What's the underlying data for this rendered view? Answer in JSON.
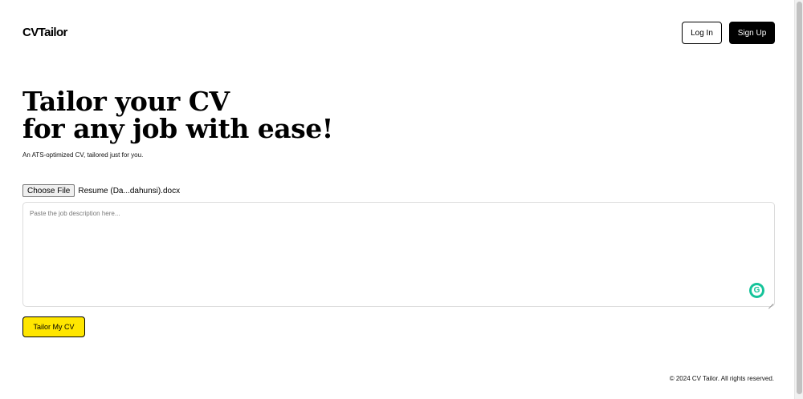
{
  "header": {
    "logo": "CVTailor",
    "login_label": "Log In",
    "signup_label": "Sign Up"
  },
  "hero": {
    "title_line1": "Tailor your CV",
    "title_line2": "for any job with ease!",
    "subtitle": "An ATS-optimized CV, tailored just for you."
  },
  "upload": {
    "choose_file_label": "Choose File",
    "file_name": "Resume (Da...dahunsi).docx"
  },
  "job_description": {
    "placeholder": "Paste the job description here...",
    "value": ""
  },
  "grammarly": {
    "icon": "grammarly-icon",
    "glyph": "G"
  },
  "actions": {
    "tailor_label": "Tailor My CV"
  },
  "footer": {
    "copyright": "© 2024 CV Tailor. All rights reserved."
  },
  "colors": {
    "accent": "#ffe600",
    "primary": "#000000",
    "background": "#ffffff",
    "grammarly": "#15c39a"
  }
}
